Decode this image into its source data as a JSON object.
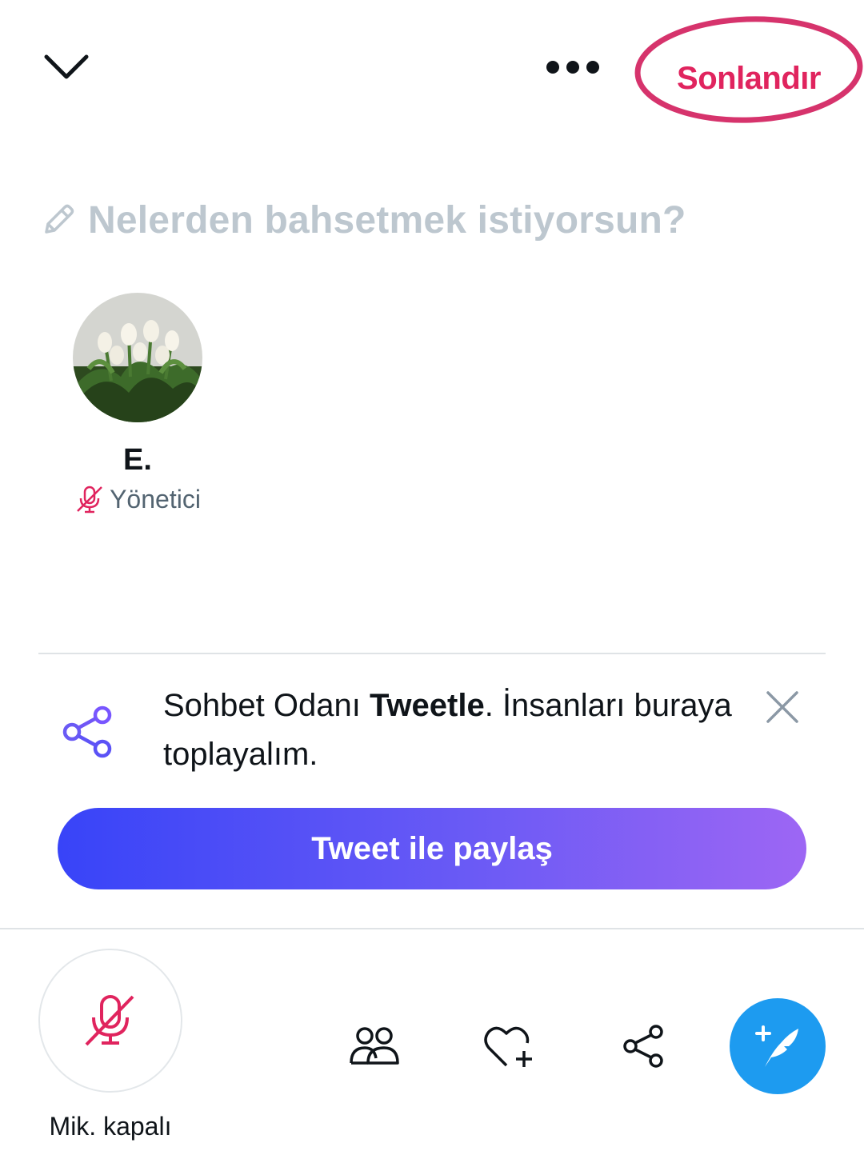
{
  "header": {
    "collapse_icon": "chevron-down-icon",
    "more_icon": "more-dots-icon",
    "end_label": "Sonlandır",
    "end_highlight_color": "#d6336c"
  },
  "topic": {
    "icon": "pencil-icon",
    "placeholder": "Nelerden bahsetmek istiyorsun?"
  },
  "speakers": [
    {
      "name": "E.",
      "role": "Yönetici",
      "role_icon": "mic-off-icon",
      "avatar": "white tulips photo"
    }
  ],
  "share_banner": {
    "icon": "share-icon",
    "text_before": "Sohbet Odanı ",
    "text_bold": "Tweetle",
    "text_after": ". İnsanları buraya toplayalım.",
    "close_icon": "close-icon",
    "button_label": "Tweet ile paylaş"
  },
  "bottom_bar": {
    "mic_icon": "mic-off-icon",
    "mic_label": "Mik. kapalı",
    "people_icon": "people-icon",
    "react_icon": "heart-plus-icon",
    "share_icon": "share-icon",
    "compose_icon": "compose-tweet-icon"
  },
  "colors": {
    "accent_blue": "#1d9bf0",
    "end_red": "#e0245e",
    "gradient_start": "#3844f8",
    "gradient_end": "#9d66f4",
    "placeholder_gray": "#bdc7cf",
    "muted_red": "#e0245e",
    "share_purple": "#7856ff"
  }
}
